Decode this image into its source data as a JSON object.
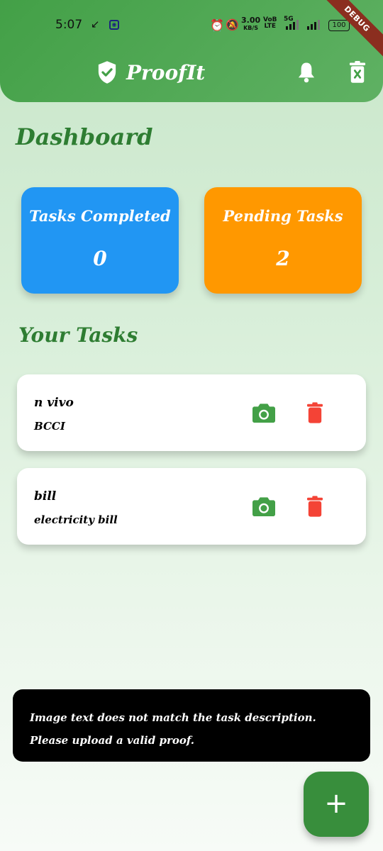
{
  "status_bar": {
    "time": "5:07",
    "speed_value": "3.00",
    "speed_unit": "KB/S",
    "volte_top": "VoB",
    "volte_bottom": "LTE",
    "network_label": "5G",
    "battery": "100"
  },
  "debug_banner": "DEBUG",
  "app_bar": {
    "title": "ProofIt",
    "logo_icon": "shield-check-icon",
    "notifications_icon": "bell-icon",
    "clear_icon": "delete-x-icon"
  },
  "dashboard": {
    "title": "Dashboard",
    "stats": [
      {
        "label": "Tasks Completed",
        "value": "0",
        "color": "#2196f3"
      },
      {
        "label": "Pending Tasks",
        "value": "2",
        "color": "#ff9800"
      }
    ]
  },
  "tasks_section": {
    "title": "Your Tasks",
    "tasks": [
      {
        "name": "n vivo",
        "description": "BCCI"
      },
      {
        "name": "bill",
        "description": "electricity bill"
      }
    ],
    "camera_icon": "camera-icon",
    "delete_icon": "trash-icon"
  },
  "snackbar": {
    "message": "Image text does not match the task description. Please upload a valid proof."
  },
  "fab": {
    "label": "+",
    "icon": "add-icon"
  },
  "colors": {
    "primary": "#43a047",
    "heading": "#2e7d32",
    "camera": "#43a047",
    "delete": "#f44336",
    "fab": "#388e3c"
  }
}
